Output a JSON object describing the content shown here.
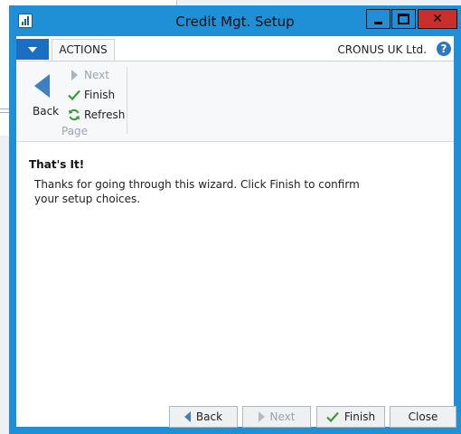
{
  "window": {
    "title": "Credit Mgt. Setup"
  },
  "topbar": {
    "tab_label": "ACTIONS",
    "company": "CRONUS UK Ltd.",
    "help_glyph": "?"
  },
  "ribbon": {
    "back_label": "Back",
    "next_label": "Next",
    "finish_label": "Finish",
    "refresh_label": "Refresh",
    "group_label": "Page"
  },
  "content": {
    "heading": "That's It!",
    "body": "Thanks for going through this wizard. Click Finish to confirm your setup choices."
  },
  "footer": {
    "back_label": "Back",
    "next_label": "Next",
    "finish_label": "Finish",
    "close_label": "Close"
  },
  "colors": {
    "window_frame": "#1f8fd6",
    "accent_blue": "#1a6fc4",
    "close_red": "#c9302c",
    "check_green": "#3a9a3a"
  },
  "icons": {
    "app": "app-icon",
    "help": "help-icon",
    "back": "back-arrow-icon",
    "next": "next-arrow-icon",
    "finish": "checkmark-icon",
    "refresh": "refresh-icon"
  }
}
